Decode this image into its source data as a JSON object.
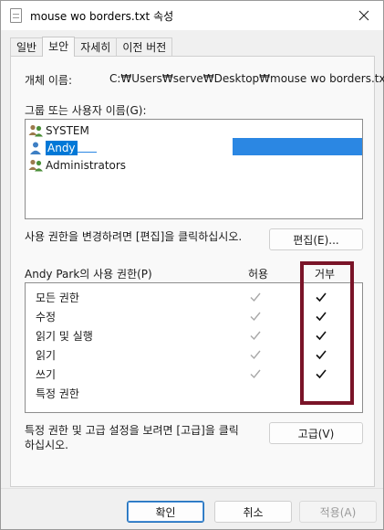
{
  "window": {
    "title": "mouse wo borders.txt 속성"
  },
  "tabs": [
    {
      "label": "일반"
    },
    {
      "label": "보안"
    },
    {
      "label": "자세히"
    },
    {
      "label": "이전 버전"
    }
  ],
  "security": {
    "object_name_label": "개체 이름:",
    "object_name_value": "C:₩Users₩serve₩Desktop₩mouse wo borders.txt",
    "groups_label": "그룹 또는 사용자 이름(G):",
    "users": [
      {
        "name": "SYSTEM",
        "icon": "group-icon"
      },
      {
        "name": "Andy",
        "icon": "user-icon",
        "selected": true
      },
      {
        "name": "Administrators",
        "icon": "group-icon"
      }
    ],
    "change_note": "사용 권한을 변경하려면 [편집]을 클릭하십시오.",
    "edit_button": "편집(E)...",
    "perm_header": "Andy Park의 사용 권한(P)",
    "allow_header": "허용",
    "deny_header": "거부",
    "permissions": [
      {
        "name": "모든 권한",
        "allow": true,
        "deny": true
      },
      {
        "name": "수정",
        "allow": true,
        "deny": true
      },
      {
        "name": "읽기 및 실행",
        "allow": true,
        "deny": true
      },
      {
        "name": "읽기",
        "allow": true,
        "deny": true
      },
      {
        "name": "쓰기",
        "allow": true,
        "deny": true
      },
      {
        "name": "특정 권한",
        "allow": false,
        "deny": false
      }
    ],
    "advanced_note_line1": "특정 권한 및 고급 설정을 보려면 [고급]을 클릭",
    "advanced_note_line2": "하십시오.",
    "advanced_button": "고급(V)"
  },
  "footer": {
    "ok_button": "확인",
    "cancel_button": "취소",
    "apply_button": "적용(A)"
  },
  "colors": {
    "accent": "#0078d7",
    "highlight_box": "#7a1428",
    "inherited_check": "#a8a8a8"
  }
}
